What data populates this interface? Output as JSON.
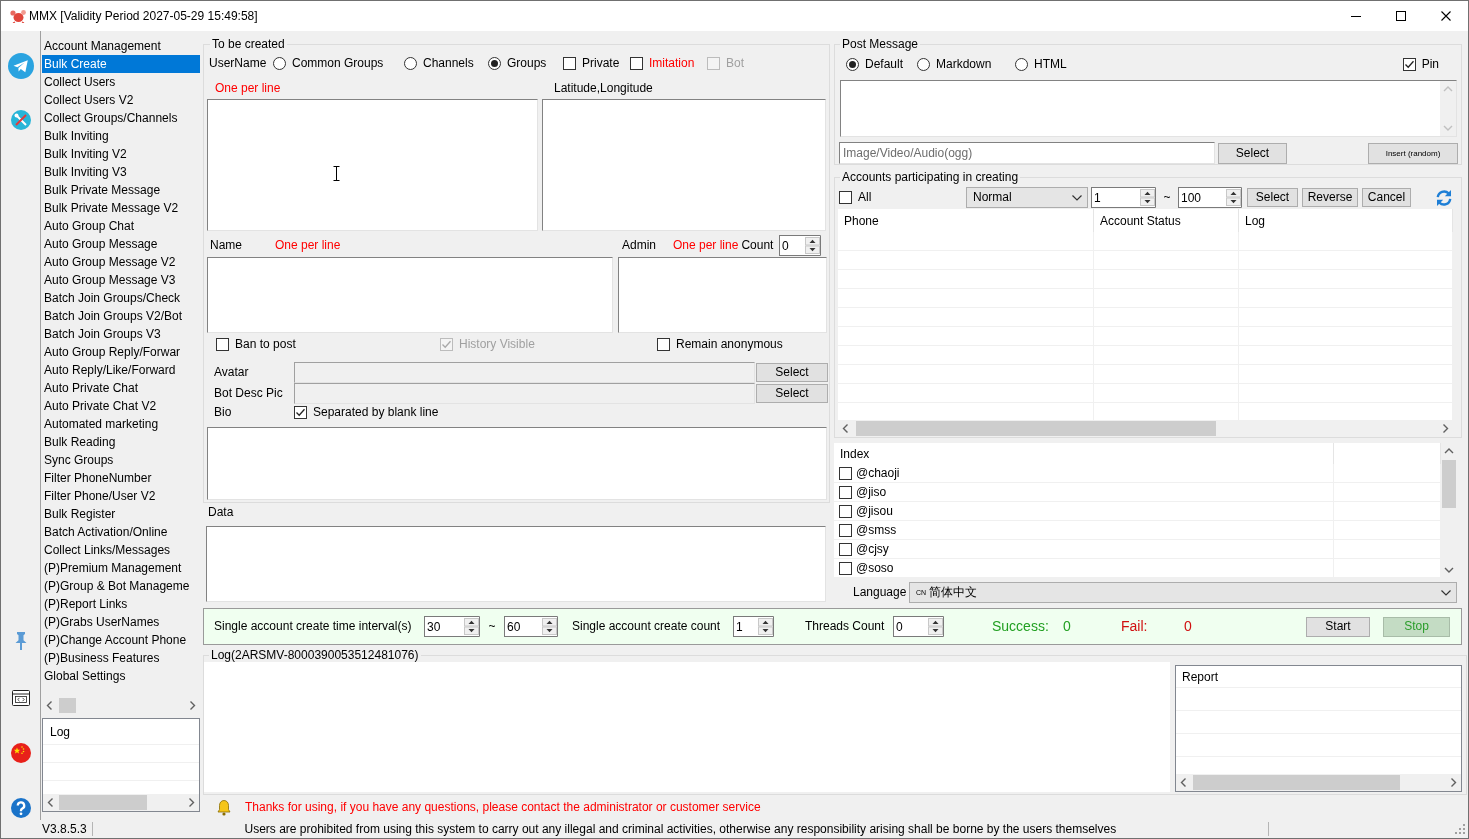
{
  "window": {
    "title": "MMX [Validity Period 2027-05-29 15:49:58]"
  },
  "sidebar": {
    "items": [
      {
        "label": "Account Management",
        "selected": false
      },
      {
        "label": "Bulk Create",
        "selected": true
      },
      {
        "label": "Collect Users",
        "selected": false
      },
      {
        "label": "Collect Users V2",
        "selected": false
      },
      {
        "label": "Collect Groups/Channels",
        "selected": false
      },
      {
        "label": "Bulk Inviting",
        "selected": false
      },
      {
        "label": "Bulk Inviting V2",
        "selected": false
      },
      {
        "label": "Bulk Inviting V3",
        "selected": false
      },
      {
        "label": "Bulk Private Message",
        "selected": false
      },
      {
        "label": "Bulk Private Message V2",
        "selected": false
      },
      {
        "label": "Auto Group Chat",
        "selected": false
      },
      {
        "label": "Auto Group Message",
        "selected": false
      },
      {
        "label": "Auto Group Message V2",
        "selected": false
      },
      {
        "label": "Auto Group Message V3",
        "selected": false
      },
      {
        "label": "Batch Join Groups/Check",
        "selected": false
      },
      {
        "label": "Batch Join Groups V2/Bot",
        "selected": false
      },
      {
        "label": "Batch Join Groups V3",
        "selected": false
      },
      {
        "label": "Auto Group Reply/Forwar",
        "selected": false
      },
      {
        "label": "Auto Reply/Like/Forward",
        "selected": false
      },
      {
        "label": "Auto Private Chat",
        "selected": false
      },
      {
        "label": "Auto Private Chat V2",
        "selected": false
      },
      {
        "label": "Automated marketing",
        "selected": false
      },
      {
        "label": "Bulk Reading",
        "selected": false
      },
      {
        "label": "Sync Groups",
        "selected": false
      },
      {
        "label": "Filter PhoneNumber",
        "selected": false
      },
      {
        "label": "Filter Phone/User V2",
        "selected": false
      },
      {
        "label": "Bulk Register",
        "selected": false
      },
      {
        "label": "Batch Activation/Online",
        "selected": false
      },
      {
        "label": "Collect Links/Messages",
        "selected": false
      },
      {
        "label": "(P)Premium Management",
        "selected": false
      },
      {
        "label": "(P)Group & Bot Manageme",
        "selected": false
      },
      {
        "label": "(P)Report Links",
        "selected": false
      },
      {
        "label": "(P)Grabs UserNames",
        "selected": false
      },
      {
        "label": "(P)Change Account Phone",
        "selected": false
      },
      {
        "label": "(P)Business Features",
        "selected": false
      },
      {
        "label": "Global Settings",
        "selected": false
      }
    ]
  },
  "side_log": {
    "columns": [
      "Log"
    ]
  },
  "create_group": {
    "title": "To be created",
    "username_label": "UserName",
    "chat_types": [
      {
        "label": "Common Groups",
        "selected": false
      },
      {
        "label": "Channels",
        "selected": false
      },
      {
        "label": "Groups",
        "selected": true
      }
    ],
    "options": [
      {
        "label": "Private",
        "checked": false,
        "disabled": false,
        "color": "#000000"
      },
      {
        "label": "Imitation",
        "checked": false,
        "disabled": false,
        "color": "#ff0000"
      },
      {
        "label": "Bot",
        "checked": false,
        "disabled": true,
        "color": "#a0a0a0"
      }
    ],
    "usernames_hint": "One per line",
    "coordinates_label": "Latitude,Longitude",
    "name_label": "Name",
    "name_hint": "One per line",
    "admin_label": "Admin",
    "admin_hint": "One per line",
    "count_label": "Count",
    "count_value": "0",
    "flags": [
      {
        "label": "Ban to post",
        "checked": false,
        "disabled": false
      },
      {
        "label": "History Visible",
        "checked": true,
        "disabled": true
      },
      {
        "label": "Remain anonymous",
        "checked": false,
        "disabled": false
      }
    ],
    "pictures": [
      {
        "label": "Avatar",
        "button": "Select"
      },
      {
        "label": "Bot Desc Pic",
        "button": "Select"
      }
    ],
    "bio": {
      "label": "Bio",
      "separator": {
        "label": "Separated by blank line",
        "checked": true
      }
    }
  },
  "data_section": {
    "label": "Data"
  },
  "post_message": {
    "title": "Post Message",
    "formats": [
      {
        "label": "Default",
        "selected": true
      },
      {
        "label": "Markdown",
        "selected": false
      },
      {
        "label": "HTML",
        "selected": false
      }
    ],
    "pin": {
      "label": "Pin",
      "checked": true
    },
    "media_placeholder": "Image/Video/Audio(ogg)",
    "select_button": "Select",
    "insert_button": "Insert (random)"
  },
  "accounts": {
    "title": "Accounts participating in creating",
    "all": {
      "label": "All",
      "checked": false
    },
    "filter": "Normal",
    "range_from": "1",
    "range_separator": "~",
    "range_to": "100",
    "buttons": [
      "Select",
      "Reverse",
      "Cancel"
    ],
    "table": {
      "columns": [
        "Phone",
        "Account Status",
        "Log"
      ]
    }
  },
  "index_list": {
    "header": "Index",
    "items": [
      {
        "label": "@chaoji",
        "checked": false
      },
      {
        "label": "@jiso",
        "checked": false
      },
      {
        "label": "@jisou",
        "checked": false
      },
      {
        "label": "@smss",
        "checked": false
      },
      {
        "label": "@cjsy",
        "checked": false
      },
      {
        "label": "@soso",
        "checked": false
      }
    ]
  },
  "language": {
    "label": "Language",
    "flag": "CN",
    "value": "简体中文"
  },
  "run_bar": {
    "interval_label": "Single account create time interval(s)",
    "interval_from": "30",
    "interval_separator": "~",
    "interval_to": "60",
    "count_label": "Single account create count",
    "count": "1",
    "threads_label": "Threads Count",
    "threads": "0",
    "success_label": "Success:",
    "success": "0",
    "fail_label": "Fail:",
    "fail": "0",
    "buttons": [
      {
        "label": "Start",
        "kind": "start"
      },
      {
        "label": "Stop",
        "kind": "stop"
      }
    ]
  },
  "log": {
    "title": "Log(2ARSMV-8000390053512481076)",
    "report": {
      "columns": [
        "Report"
      ]
    }
  },
  "notice": "Thanks for using, if you have any questions, please contact the administrator or customer service",
  "status_bar": {
    "version": "V3.8.5.3",
    "message": "Users are prohibited from using this system to carry out any illegal and criminal activities, otherwise any responsibility arising shall be borne by the users themselves"
  }
}
